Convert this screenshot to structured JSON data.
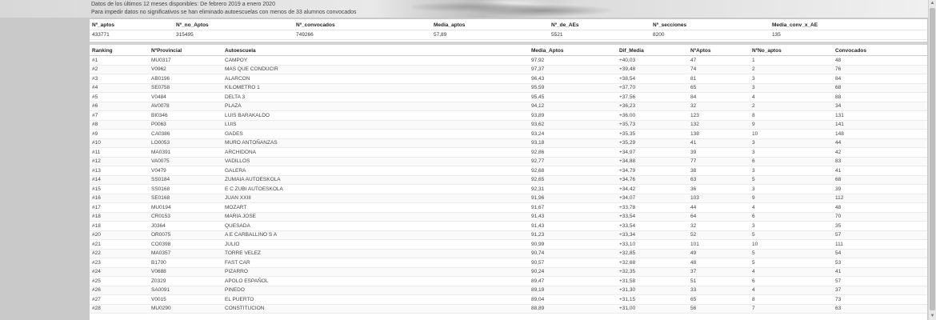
{
  "header": {
    "info_line_1": "Datos de los últimos 12 meses disponibles: De febrero 2019 a enero 2020",
    "info_line_2": "Para impedir datos no significativos se han eliminado autoescuelas con menos de 33 alumnos convocados"
  },
  "stats": {
    "headers": [
      "Nº_aptos",
      "Nº_no_Aptos",
      "Nº_convocados",
      "Media_aptos",
      "Nº_de_AEs",
      "Nº_secciones",
      "Media_conv_x_AE"
    ],
    "values": [
      "433771",
      "315495",
      "749266",
      "57,89",
      "5521",
      "8200",
      "135"
    ]
  },
  "table": {
    "columns": [
      "Ranking",
      "NºProvincial",
      "Autoescuela",
      "Media_Aptos",
      "Dif_Media",
      "NºAptos",
      "NºNo_aptos",
      "Convocados"
    ],
    "rows": [
      [
        "#1",
        "MU0317",
        "CAMPOY",
        "97,92",
        "+40,03",
        "47",
        "1",
        "48"
      ],
      [
        "#2",
        "V0962",
        "MAS QUE CONDUCIR",
        "97,37",
        "+39,48",
        "74",
        "2",
        "76"
      ],
      [
        "#3",
        "AB0196",
        "ALARCON",
        "96,43",
        "+38,54",
        "81",
        "3",
        "84"
      ],
      [
        "#4",
        "SE0758",
        "KILOMETRO 1",
        "95,59",
        "+37,70",
        "65",
        "3",
        "68"
      ],
      [
        "#5",
        "V0484",
        "DELTA 3",
        "95,45",
        "+37,56",
        "84",
        "4",
        "88"
      ],
      [
        "#6",
        "AV0078",
        "PLAZA",
        "94,12",
        "+36,23",
        "32",
        "2",
        "34"
      ],
      [
        "#7",
        "BI0346",
        "LUIS BARAKALDO",
        "93,89",
        "+36,00",
        "123",
        "8",
        "131"
      ],
      [
        "#8",
        "P0063",
        "LUIS",
        "93,62",
        "+35,73",
        "132",
        "9",
        "141"
      ],
      [
        "#9",
        "CA0386",
        "GADES",
        "93,24",
        "+35,35",
        "138",
        "10",
        "148"
      ],
      [
        "#10",
        "LO0053",
        "MURO ANTOÑANZAS",
        "93,18",
        "+35,29",
        "41",
        "3",
        "44"
      ],
      [
        "#11",
        "MA0391",
        "ARCHIDONA",
        "92,86",
        "+34,97",
        "39",
        "3",
        "42"
      ],
      [
        "#12",
        "VA0075",
        "VADILLOS",
        "92,77",
        "+34,88",
        "77",
        "6",
        "83"
      ],
      [
        "#13",
        "V0479",
        "GALERA",
        "92,68",
        "+34,79",
        "38",
        "3",
        "41"
      ],
      [
        "#14",
        "SS0184",
        "ZUMAIA AUTOESKOLA",
        "92,65",
        "+34,76",
        "63",
        "5",
        "68"
      ],
      [
        "#15",
        "SS0168",
        "E C ZUBI AUTOESKOLA",
        "92,31",
        "+34,42",
        "36",
        "3",
        "39"
      ],
      [
        "#16",
        "SE0168",
        "JUAN XXIII",
        "91,96",
        "+34,07",
        "103",
        "9",
        "112"
      ],
      [
        "#17",
        "MU0194",
        "MOZART",
        "91,67",
        "+33,78",
        "44",
        "4",
        "48"
      ],
      [
        "#18",
        "CR0153",
        "MARIA JOSE",
        "91,43",
        "+33,54",
        "64",
        "6",
        "70"
      ],
      [
        "#18",
        "J0364",
        "QUESADA",
        "91,43",
        "+33,54",
        "32",
        "3",
        "35"
      ],
      [
        "#20",
        "OR0075",
        "A E CARBALLINO S A",
        "91,23",
        "+33,34",
        "52",
        "5",
        "57"
      ],
      [
        "#21",
        "CO0398",
        "JULIO",
        "90,99",
        "+33,10",
        "101",
        "10",
        "111"
      ],
      [
        "#22",
        "MA0357",
        "TORRE VELEZ",
        "90,74",
        "+32,85",
        "49",
        "5",
        "54"
      ],
      [
        "#23",
        "B1700",
        "FAST CAR",
        "90,57",
        "+32,68",
        "48",
        "5",
        "53"
      ],
      [
        "#24",
        "V0688",
        "PIZARRO",
        "90,24",
        "+32,35",
        "37",
        "4",
        "41"
      ],
      [
        "#25",
        "Z0329",
        "APOLO ESPAÑOL",
        "89,47",
        "+31,58",
        "51",
        "6",
        "57"
      ],
      [
        "#26",
        "SA0091",
        "PINEDO",
        "89,19",
        "+31,30",
        "33",
        "4",
        "37"
      ],
      [
        "#27",
        "V0015",
        "EL PUERTO",
        "89,04",
        "+31,15",
        "65",
        "8",
        "73"
      ],
      [
        "#28",
        "MU0290",
        "CONSTITUCION",
        "88,89",
        "+31,00",
        "56",
        "7",
        "63"
      ]
    ]
  }
}
